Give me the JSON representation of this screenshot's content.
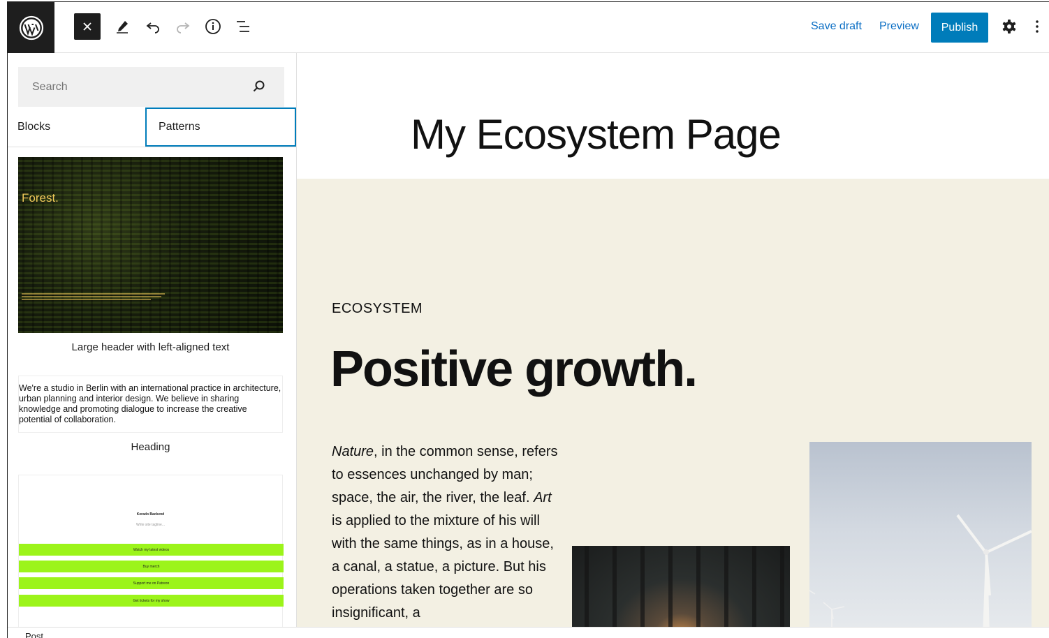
{
  "header": {
    "save_draft": "Save draft",
    "preview": "Preview",
    "publish": "Publish"
  },
  "sidebar": {
    "search_placeholder": "Search",
    "tabs": [
      {
        "label": "Blocks"
      },
      {
        "label": "Patterns"
      }
    ],
    "patterns": [
      {
        "preview_title": "Forest.",
        "caption": "Large header with left-aligned text"
      },
      {
        "preview_text": "We're a studio in Berlin with an international practice in architecture, urban planning and interior design. We believe in sharing knowledge and promoting dialogue to increase the creative potential of collaboration.",
        "caption": "Heading"
      },
      {
        "preview_name": "Kerado Backend",
        "preview_tagline": "Write site tagline...",
        "buttons": [
          {
            "label": "Watch my latest videos"
          },
          {
            "label": "Buy merch"
          },
          {
            "label": "Support me on Patreon"
          },
          {
            "label": "Get tickets for my show"
          }
        ],
        "button_color": "#9cf41a"
      }
    ]
  },
  "canvas": {
    "page_title": "My Ecosystem Page",
    "eyebrow": "ECOSYSTEM",
    "headline": "Positive growth.",
    "body": {
      "p1_em": "Nature",
      "p1_a": ", in the common sense, refers to essences unchanged by man; space, the air, the river, the leaf. ",
      "p1_em2": "Art",
      "p1_b": " is applied to the mixture of his will with the same things, as in a house, a canal, a statue, a picture. But his operations taken together are so insignificant, a"
    },
    "background_color": "#f3f0e3"
  },
  "footer": {
    "breadcrumb": "Post"
  },
  "colors": {
    "accent": "#007cba",
    "link": "#0a6ec4",
    "dark": "#1e1e1e"
  }
}
